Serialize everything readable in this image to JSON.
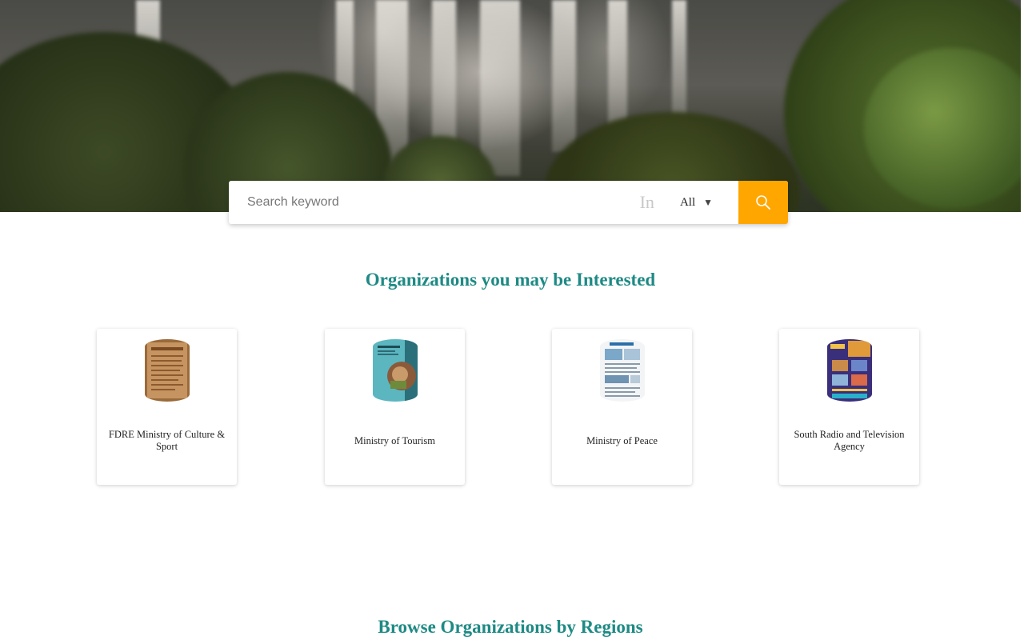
{
  "search": {
    "placeholder": "Search keyword",
    "in_label": "In",
    "scope_value": "All",
    "accent_color": "#ffa600"
  },
  "sections": {
    "interested_title": "Organizations you may be Interested",
    "regions_title": "Browse Organizations by Regions"
  },
  "organizations": [
    {
      "name": "FDRE Ministry of Culture & Sport"
    },
    {
      "name": "Ministry of Tourism"
    },
    {
      "name": "Ministry of Peace"
    },
    {
      "name": "South Radio and Television Agency"
    }
  ],
  "colors": {
    "heading": "#1e8a84",
    "search_button": "#ffa600"
  },
  "icons": {
    "search_button": "search-icon",
    "scope_caret": "caret-down-icon"
  }
}
